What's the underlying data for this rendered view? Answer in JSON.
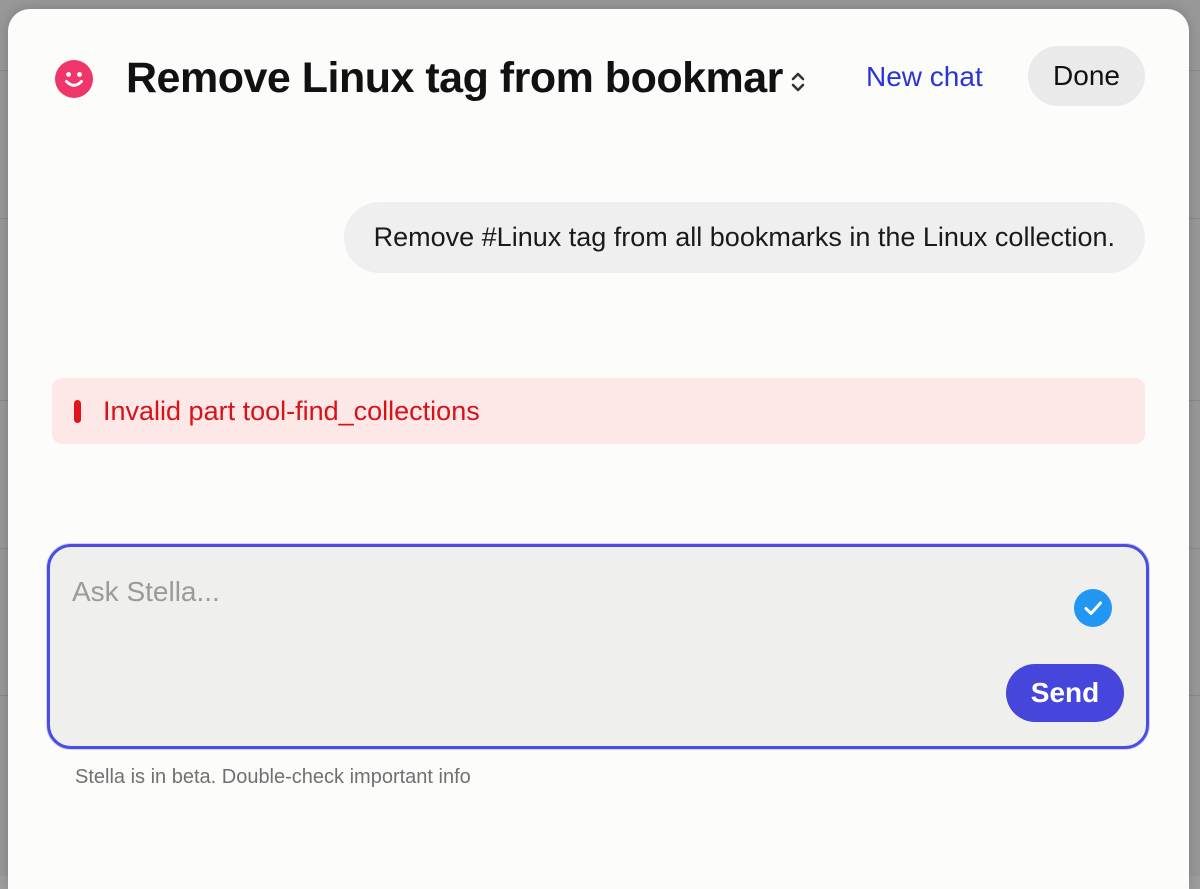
{
  "header": {
    "title": "Remove Linux tag from bookmar",
    "new_chat_label": "New chat",
    "done_label": "Done",
    "logo_icon": "smiley-face-icon",
    "switcher_icon": "chevron-up-down-icon"
  },
  "messages": [
    {
      "role": "user",
      "text": "Remove #Linux tag from all bookmarks in the Linux collection."
    }
  ],
  "error": {
    "text": "Invalid part tool-find_collections",
    "icon": "error-bar-icon"
  },
  "composer": {
    "placeholder": "Ask Stella...",
    "value": "",
    "check_icon": "checkmark-circle-icon",
    "send_label": "Send"
  },
  "disclaimer": "Stella is in beta. Double-check important info",
  "colors": {
    "accent": "#4646dd",
    "link": "#2a35d6",
    "logo": "#f0356b",
    "error_text": "#d81217",
    "error_bg": "#fde7e7",
    "check": "#2196f3"
  }
}
